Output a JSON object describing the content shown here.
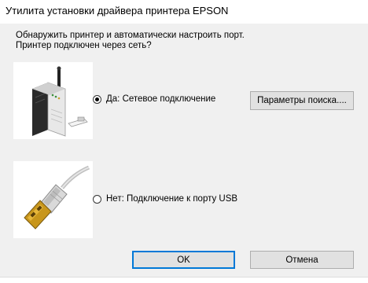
{
  "window": {
    "title": "Утилита установки драйвера принтера EPSON"
  },
  "prompt": {
    "line1": "Обнаружить принтер и автоматически настроить порт.",
    "line2": "Принтер подключен через сеть?"
  },
  "options": {
    "network": {
      "label": "Да: Сетевое подключение",
      "selected": true,
      "icon": "network-router-icon"
    },
    "usb": {
      "label": "Нет: Подключение к порту USB",
      "selected": false,
      "icon": "usb-cable-icon"
    }
  },
  "buttons": {
    "search_params": "Параметры поиска....",
    "ok": "OK",
    "cancel": "Отмена"
  },
  "colors": {
    "dialog_bg": "#f0f0f0",
    "button_bg": "#e1e1e1",
    "default_button_border": "#0078d7"
  }
}
